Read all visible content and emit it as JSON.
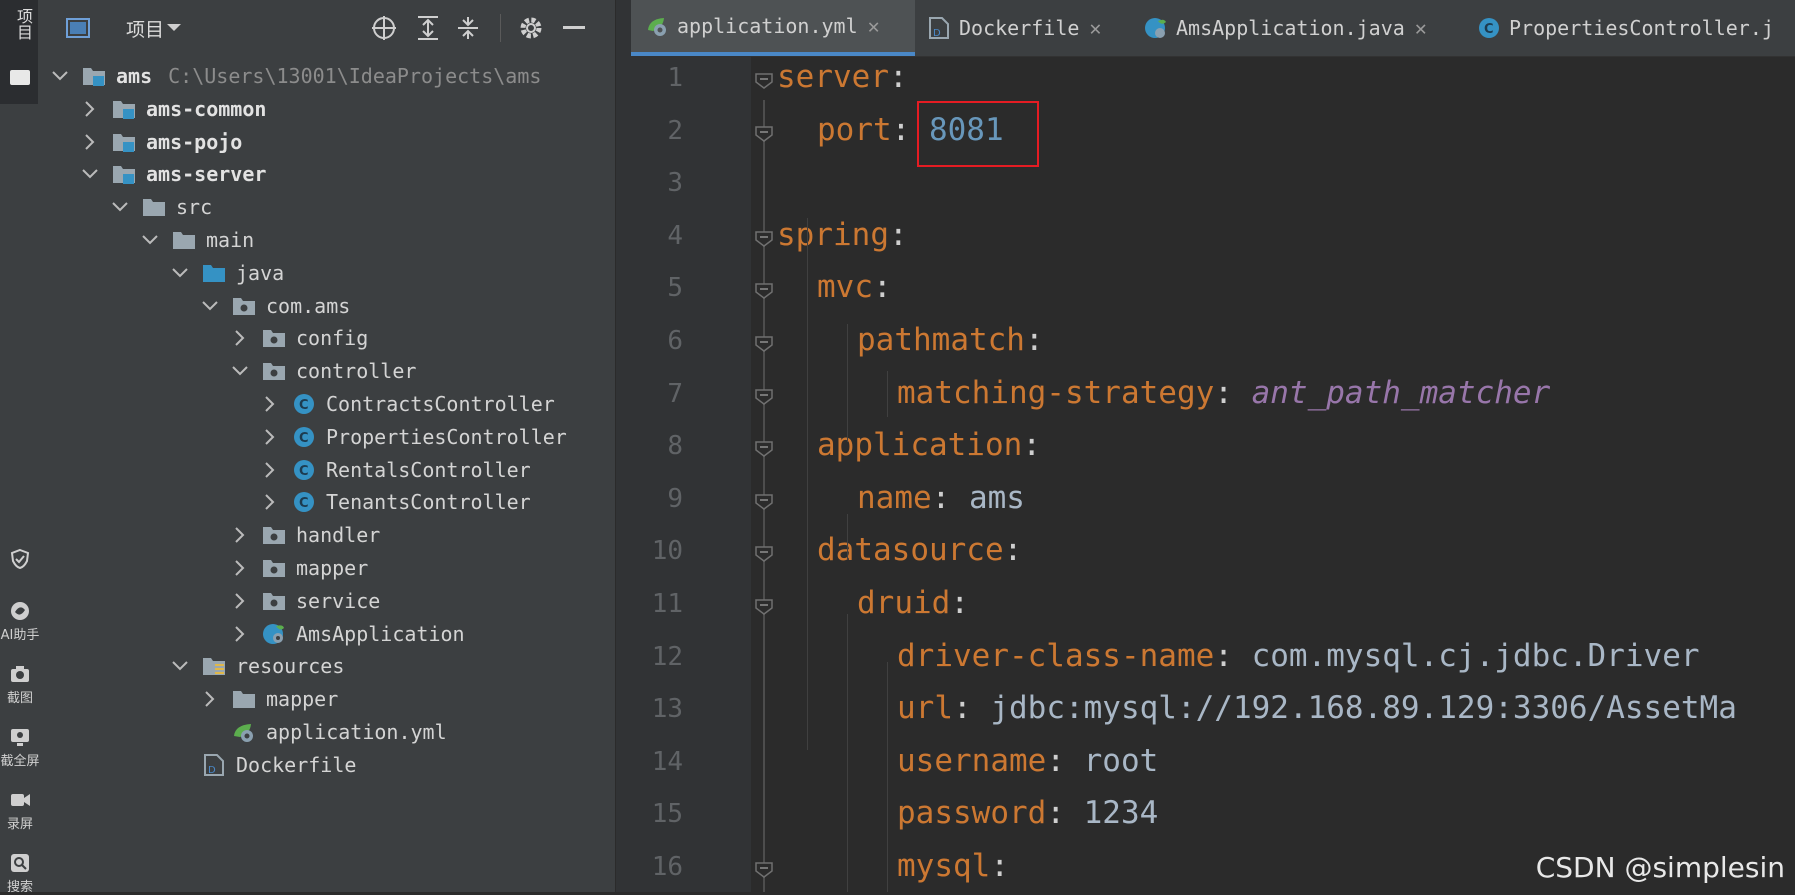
{
  "side_strip": {
    "panel_tab": "项目",
    "tools": [
      {
        "label": "",
        "icon": "shield-icon"
      },
      {
        "label": "AI助手",
        "icon": "ai-assistant-icon"
      },
      {
        "label": "截图",
        "icon": "camera-icon"
      },
      {
        "label": "截全屏",
        "icon": "fullscreen-capture-icon"
      },
      {
        "label": "录屏",
        "icon": "video-record-icon"
      },
      {
        "label": "搜索",
        "icon": "search-icon"
      }
    ]
  },
  "project_panel": {
    "title": "项目",
    "tree": [
      {
        "label": "ams",
        "path": "C:\\Users\\13001\\IdeaProjects\\ams",
        "type": "module",
        "expanded": true,
        "bold": true
      },
      {
        "label": "ams-common",
        "type": "module",
        "expanded": false,
        "bold": true
      },
      {
        "label": "ams-pojo",
        "type": "module",
        "expanded": false,
        "bold": true
      },
      {
        "label": "ams-server",
        "type": "module",
        "expanded": true,
        "bold": true
      },
      {
        "label": "src",
        "type": "folder",
        "expanded": true
      },
      {
        "label": "main",
        "type": "folder",
        "expanded": true
      },
      {
        "label": "java",
        "type": "source-folder",
        "expanded": true
      },
      {
        "label": "com.ams",
        "type": "package",
        "expanded": true
      },
      {
        "label": "config",
        "type": "package",
        "expanded": false
      },
      {
        "label": "controller",
        "type": "package",
        "expanded": true
      },
      {
        "label": "ContractsController",
        "type": "class",
        "expanded": false
      },
      {
        "label": "PropertiesController",
        "type": "class",
        "expanded": false
      },
      {
        "label": "RentalsController",
        "type": "class",
        "expanded": false
      },
      {
        "label": "TenantsController",
        "type": "class",
        "expanded": false
      },
      {
        "label": "handler",
        "type": "package",
        "expanded": false
      },
      {
        "label": "mapper",
        "type": "package",
        "expanded": false
      },
      {
        "label": "service",
        "type": "package",
        "expanded": false
      },
      {
        "label": "AmsApplication",
        "type": "spring-class",
        "expanded": false
      },
      {
        "label": "resources",
        "type": "resources-folder",
        "expanded": true
      },
      {
        "label": "mapper",
        "type": "folder",
        "expanded": false
      },
      {
        "label": "application.yml",
        "type": "yml"
      },
      {
        "label": "Dockerfile",
        "type": "dockerfile"
      }
    ]
  },
  "editor": {
    "tabs": [
      {
        "label": "application.yml",
        "icon": "yml-icon",
        "active": true
      },
      {
        "label": "Dockerfile",
        "icon": "dockerfile-icon",
        "active": false
      },
      {
        "label": "AmsApplication.java",
        "icon": "spring-class-icon",
        "active": false
      },
      {
        "label": "PropertiesController.j",
        "icon": "class-icon",
        "active": false
      }
    ],
    "lines": [
      {
        "n": "1",
        "key": "server",
        "sep": ":",
        "value": ""
      },
      {
        "n": "2",
        "key": "port",
        "sep": ": ",
        "value": "8081"
      },
      {
        "n": "3",
        "key": "",
        "sep": "",
        "value": ""
      },
      {
        "n": "4",
        "key": "spring",
        "sep": ":",
        "value": ""
      },
      {
        "n": "5",
        "key": "mvc",
        "sep": ":",
        "value": ""
      },
      {
        "n": "6",
        "key": "pathmatch",
        "sep": ":",
        "value": ""
      },
      {
        "n": "7",
        "key": "matching-strategy",
        "sep": ": ",
        "value": "ant_path_matcher"
      },
      {
        "n": "8",
        "key": "application",
        "sep": ":",
        "value": ""
      },
      {
        "n": "9",
        "key": "name",
        "sep": ": ",
        "value": "ams"
      },
      {
        "n": "10",
        "key": "datasource",
        "sep": ":",
        "value": ""
      },
      {
        "n": "11",
        "key": "druid",
        "sep": ":",
        "value": ""
      },
      {
        "n": "12",
        "key": "driver-class-name",
        "sep": ": ",
        "value": "com.mysql.cj.jdbc.Driver"
      },
      {
        "n": "13",
        "key": "url",
        "sep": ": ",
        "value": "jdbc:mysql://192.168.89.129:3306/AssetMa"
      },
      {
        "n": "14",
        "key": "username",
        "sep": ": ",
        "value": "root"
      },
      {
        "n": "15",
        "key": "password",
        "sep": ": ",
        "value": "1234"
      },
      {
        "n": "16",
        "key": "mysql",
        "sep": ":",
        "value": ""
      }
    ]
  },
  "watermark": "CSDN @simplesin",
  "colors": {
    "key": "#cc7832",
    "number": "#6897bb",
    "enum": "#9876aa",
    "string": "#a9b7c6",
    "highlight_box": "#e51c23",
    "active_tab_underline": "#4a88c7"
  }
}
